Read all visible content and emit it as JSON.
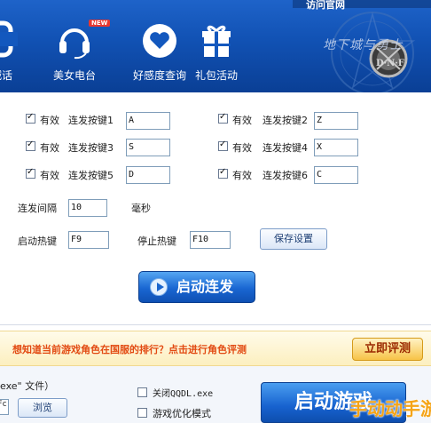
{
  "header": {
    "corner_text": "访问官网",
    "tools": [
      {
        "label": "喊话",
        "icon": "phone-icon"
      },
      {
        "label": "美女电台",
        "icon": "headphones-icon",
        "badge": "NEW"
      },
      {
        "label": "好感度查询",
        "icon": "heart-icon"
      },
      {
        "label": "礼包活动",
        "icon": "gift-icon"
      }
    ],
    "logo_text": "地下城与勇士",
    "logo_dnf": "D·N·F"
  },
  "keys": [
    {
      "check": "有效",
      "label": "连发按键1",
      "value": "A"
    },
    {
      "check": "有效",
      "label": "连发按键2",
      "value": "Z"
    },
    {
      "check": "有效",
      "label": "连发按键3",
      "value": "S"
    },
    {
      "check": "有效",
      "label": "连发按键4",
      "value": "X"
    },
    {
      "check": "有效",
      "label": "连发按键5",
      "value": "D"
    },
    {
      "check": "有效",
      "label": "连发按键6",
      "value": "C"
    }
  ],
  "interval": {
    "label": "连发间隔",
    "value": "10",
    "unit": "毫秒"
  },
  "hotkeys": {
    "start_label": "启动热键",
    "start_value": "F9",
    "stop_label": "停止热键",
    "stop_value": "F10"
  },
  "buttons": {
    "save": "保存设置",
    "start_burst": "启动连发",
    "rate": "立即评测",
    "browse": "浏览",
    "launch": "启动游戏"
  },
  "banner": {
    "text": "想知道当前游戏角色在国服的排行？点击进行角色评测"
  },
  "bottom": {
    "file_text": "exe\" 文件）",
    "path_value": "Fc",
    "opt1": "关闭QQDL.exe",
    "opt2": "游戏优化模式"
  },
  "watermark": "手动动手游",
  "colors": {
    "toolbar": "#1151b3",
    "accent_blue": "#1966d2",
    "banner_text": "#e24a12",
    "rate_button": "#f7c347"
  }
}
